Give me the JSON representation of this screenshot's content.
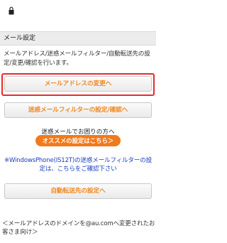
{
  "status_bar": {
    "icon": "lock-icon"
  },
  "section": {
    "title": "メール設定"
  },
  "description": "メールアドレス/迷惑メールフィルター/自動転送先の設定/変更/確認を行います。",
  "buttons": {
    "change_address": "メールアドレスの変更へ",
    "spam_filter": "迷惑メールフィルターの設定/確認へ",
    "auto_forward": "自動転送先の設定へ"
  },
  "recommend": {
    "caption": "迷惑メールでお困りの方へ",
    "button": "オススメの設定はこちら＞"
  },
  "notice": {
    "text": "※WindowsPhone(IS12T)の迷惑メールフィルターの設定は、こちらをご確認下さい"
  },
  "footer": {
    "text": "＜メールアドレスのドメインを@au.comへ変更されたお客さま向け＞"
  },
  "colors": {
    "accent_orange": "#f08a24",
    "highlight_red": "#e52b2b",
    "link_blue": "#1a3fbf"
  }
}
